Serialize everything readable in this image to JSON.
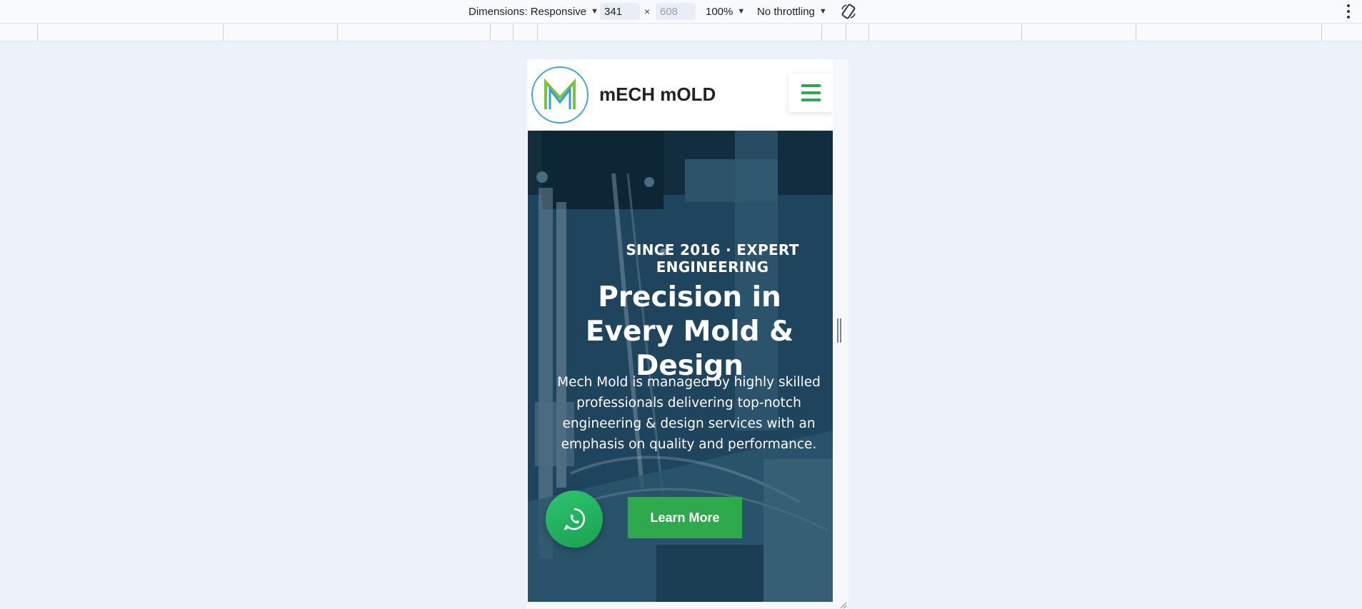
{
  "devtools": {
    "dimensions_label": "Dimensions: Responsive",
    "width_value": "341",
    "height_placeholder": "608",
    "times": "×",
    "zoom": "100%",
    "throttling": "No throttling",
    "icons": {
      "caret": "caret-down-icon",
      "rotate": "rotate-icon",
      "more": "more-vert-icon"
    }
  },
  "site": {
    "brand": "mECH mOLD",
    "colors": {
      "accent": "#2eaa4c",
      "logo_ring": "#38a9e0"
    }
  },
  "hero": {
    "kicker": "SINCE 2016 · EXPERT ENGINEERING",
    "title": "Precision in Every Mold & Design",
    "description": "Mech Mold is managed by highly skilled professionals delivering top-notch engineering & design services with an emphasis on quality and performance.",
    "cta": "Learn More"
  }
}
